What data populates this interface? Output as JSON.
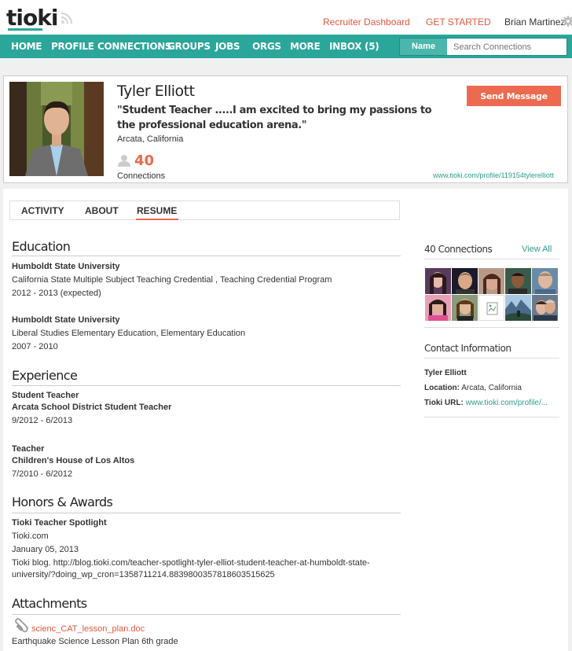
{
  "brand": {
    "logo": "tioki",
    "color": "#2aa69a",
    "accent": "#e96a4e"
  },
  "header": {
    "recruiter_link": "Recruiter Dashboard",
    "get_started_link": "GET STARTED",
    "user_name": "Brian Martinez",
    "rss_icon": "rss-icon",
    "settings_icon": "gear-icon"
  },
  "nav": {
    "items": [
      "HOME",
      "PROFILE",
      "CONNECTIONS",
      "GROUPS",
      "JOBS",
      "ORGS",
      "MORE",
      "INBOX (5)"
    ],
    "search": {
      "type_label": "Name",
      "placeholder": "Search Connections"
    }
  },
  "profile": {
    "name": "Tyler Elliott",
    "headline": "\"Student Teacher .....I am excited to bring my passions to the professional education arena.\"",
    "location": "Arcata, California",
    "connections_count": "40",
    "connections_label": "Connections",
    "send_message": "Send Message",
    "url": "www.tioki.com/profile/119154tylerelliott"
  },
  "tabs": {
    "items": [
      "ACTIVITY",
      "ABOUT",
      "RESUME"
    ],
    "active": "RESUME"
  },
  "resume": {
    "education_title": "Education",
    "education": [
      {
        "school": "Humboldt State University",
        "program": "California State Multiple Subject Teaching Credential , Teaching Credential Program",
        "dates": "2012 - 2013 (expected)"
      },
      {
        "school": "Humboldt State University",
        "program": "Liberal Studies Elementary Education, Elementary Education",
        "dates": "2007 - 2010"
      }
    ],
    "experience_title": "Experience",
    "experience": [
      {
        "title": "Student Teacher",
        "org": "Arcata School District Student Teacher",
        "dates": "9/2012 - 6/2013"
      },
      {
        "title": "Teacher",
        "org": "Children's House of Los Altos",
        "dates": "7/2010 - 6/2012"
      }
    ],
    "honors_title": "Honors & Awards",
    "honors": {
      "name": "Tioki Teacher Spotlight",
      "issuer": "Tioki.com",
      "date": "January 05, 2013",
      "desc_line1": "Tioki blog. http://blog.tioki.com/teacher-spotlight-tyler-elliot-student-teacher-at-humboldt-state-",
      "desc_line2": "university/?doing_wp_cron=1358711214.8839800357818603515625"
    },
    "attachments_title": "Attachments",
    "attachment": {
      "file": "scienc_CAT_lesson_plan.doc",
      "desc": "Earthquake Science Lesson Plan 6th grade"
    }
  },
  "sidebar": {
    "connections_title": "40 Connections",
    "view_all": "View All",
    "contact_title": "Contact Information",
    "contact_name": "Tyler Elliott",
    "location_label": "Location:",
    "location_value": "Arcata, California",
    "url_label": "Tioki URL:",
    "url_value": "www.tioki.com/profile/..."
  }
}
